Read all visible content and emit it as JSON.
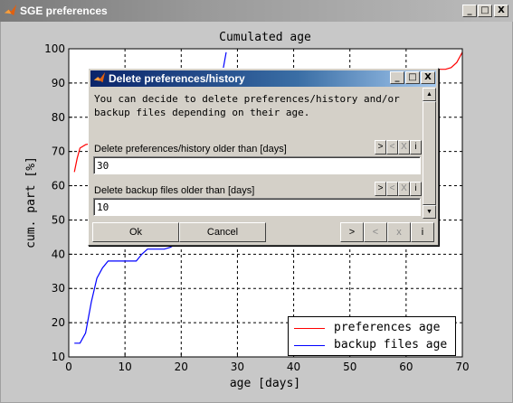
{
  "outer_window": {
    "title": "SGE preferences",
    "buttons": [
      "_",
      "□",
      "X"
    ]
  },
  "chart_data": {
    "type": "line",
    "title": "Cumulated age",
    "xlabel": "age [days]",
    "ylabel": "cum. part [%]",
    "xlim": [
      0,
      70
    ],
    "ylim": [
      10,
      100
    ],
    "xticks": [
      "0",
      "10",
      "20",
      "30",
      "40",
      "50",
      "60",
      "70"
    ],
    "yticks": [
      "10",
      "20",
      "30",
      "40",
      "50",
      "60",
      "70",
      "80",
      "90",
      "100"
    ],
    "grid": true,
    "legend_position": "bottom-right",
    "series": [
      {
        "name": "preferences age",
        "color": "#ff0000",
        "x": [
          1,
          1.5,
          2,
          3,
          66,
          67,
          68,
          69,
          70
        ],
        "y": [
          64,
          68,
          71,
          72,
          94,
          94,
          94.5,
          96,
          99
        ]
      },
      {
        "name": "backup files age",
        "color": "#0000ff",
        "x": [
          1,
          2,
          3,
          4,
          5,
          6,
          7,
          9,
          11,
          12,
          13,
          14,
          15,
          16,
          17,
          18,
          25,
          26,
          27,
          28
        ],
        "y": [
          14,
          14,
          17,
          26,
          33,
          36,
          38,
          38,
          38,
          38,
          40,
          41.5,
          41.5,
          41.5,
          41.5,
          42,
          48,
          70,
          90,
          99
        ]
      }
    ]
  },
  "dialog": {
    "title": "Delete preferences/history",
    "buttons": [
      "_",
      "□",
      "X"
    ],
    "description": "You can decide to delete preferences/history and/or\nbackup files depending on their age.",
    "fields": [
      {
        "label": "Delete preferences/history older than [days]",
        "value": "30"
      },
      {
        "label": "Delete backup files older than [days]",
        "value": "10"
      }
    ],
    "mini_buttons": [
      ">",
      "<",
      "X",
      "i"
    ],
    "ok_label": "Ok",
    "cancel_label": "Cancel",
    "nav_buttons": [
      ">",
      "<",
      "x",
      "i"
    ],
    "scroll_up": "▲",
    "scroll_down": "▼"
  }
}
